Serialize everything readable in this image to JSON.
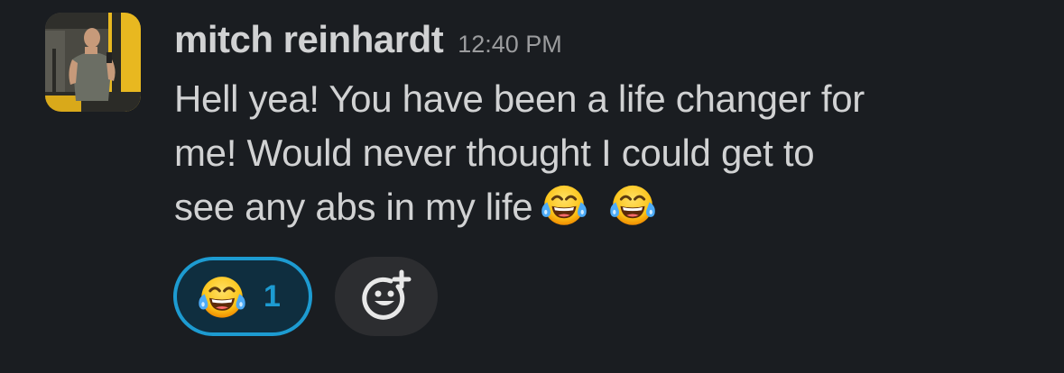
{
  "message": {
    "sender_name": "mitch reinhardt",
    "timestamp": "12:40 PM",
    "avatar_icon": "user-avatar-photo",
    "body_lines": [
      "Hell yea! You have been a life changer for",
      "me! Would never thought I could get to",
      "see any abs in my life"
    ],
    "inline_emojis": [
      "joy-emoji",
      "joy-emoji"
    ]
  },
  "reactions": [
    {
      "emoji": "joy-emoji",
      "count": "1",
      "selected": true
    }
  ],
  "add_reaction_icon": "add-reaction-icon",
  "colors": {
    "background": "#1a1d21",
    "text": "#d1d2d3",
    "timestamp": "#9b9c9e",
    "reaction_accent": "#1d9bd1",
    "add_reaction_bg": "#2c2d30"
  }
}
